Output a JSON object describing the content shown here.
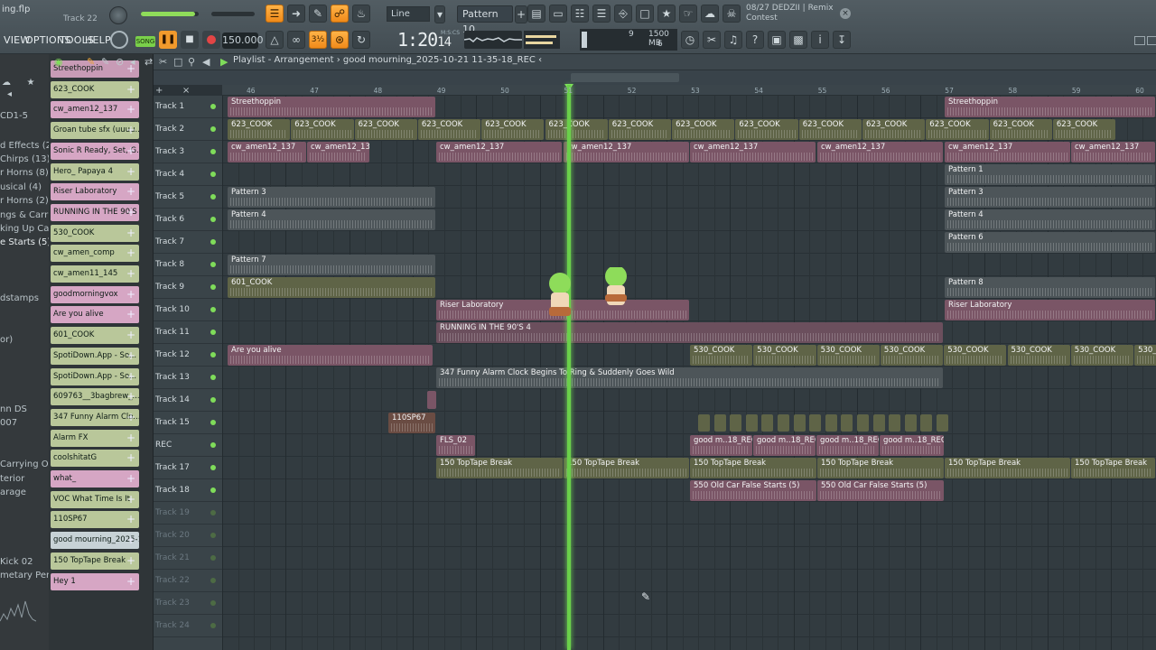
{
  "topbar": {
    "file_name": "ing.flp",
    "track_hint": "Track 22",
    "snap": "Line",
    "pattern": "Pattern 10",
    "tempo": "150.000",
    "time": "1:20",
    "time_sub": "14",
    "time_label": "M:S:CS",
    "cpu_value": "9",
    "mem_value": "1500 MB",
    "mem_sub": "6",
    "news_line1": "08/27  DEDZII | Remix",
    "news_line2": "Contest",
    "song_label": "SONG",
    "menu": [
      "VIEW",
      "OPTIONS",
      "TOOLS",
      "HELP"
    ]
  },
  "playlist": {
    "title": "Playlist - Arrangement",
    "arrangement": "good mourning_2025-10-21 11-35-18_REC",
    "bars": [
      "46",
      "47",
      "48",
      "49",
      "50",
      "51",
      "52",
      "53",
      "54",
      "55",
      "56",
      "57",
      "58",
      "59",
      "60"
    ]
  },
  "browser": {
    "items": [
      "CD1-5",
      "d Effects (2)",
      "Chirps (13)",
      "r Horns (8)",
      "usical (4)",
      "r Horns (2)",
      "ngs & Carria",
      "king Up Car)",
      "e Starts (5)",
      "dstamps",
      "or)",
      "nn DS",
      "007",
      "Carrying On",
      "terior",
      "arage",
      "Kick 02",
      "metary Perc"
    ]
  },
  "channels": [
    {
      "name": "Streethoppin",
      "color": "#c89bb6"
    },
    {
      "name": "623_COOK",
      "color": "#b9c79a"
    },
    {
      "name": "cw_amen12_137",
      "color": "#d6a6c4"
    },
    {
      "name": "Groan tube sfx (uuuu...",
      "color": "#b9c79a"
    },
    {
      "name": "Sonic R Ready, Set, G...",
      "color": "#d6a6c4"
    },
    {
      "name": "Hero_ Papaya 4",
      "color": "#b9c79a"
    },
    {
      "name": "Riser Laboratory",
      "color": "#d6a6c4"
    },
    {
      "name": "RUNNING IN THE 90'S 4",
      "color": "#d6a6c4"
    },
    {
      "name": "530_COOK",
      "color": "#b9c79a"
    },
    {
      "name": "cw_amen_comp",
      "color": "#b9c79a"
    },
    {
      "name": "cw_amen11_145",
      "color": "#b9c79a"
    },
    {
      "name": "goodmorningvox",
      "color": "#d6a6c4"
    },
    {
      "name": "Are you alive",
      "color": "#d6a6c4"
    },
    {
      "name": "601_COOK",
      "color": "#b9c79a"
    },
    {
      "name": "SpotiDown.App - So...",
      "color": "#b9c79a"
    },
    {
      "name": "SpotiDown.App - So...",
      "color": "#b9c79a"
    },
    {
      "name": "609763__3bagbrew_...",
      "color": "#b9c79a"
    },
    {
      "name": "347 Funny Alarm Clo...",
      "color": "#b9c79a"
    },
    {
      "name": "Alarm FX",
      "color": "#b9c79a"
    },
    {
      "name": "coolshitatG",
      "color": "#b9c79a"
    },
    {
      "name": "what_",
      "color": "#d6a6c4"
    },
    {
      "name": "VOC What Time Is It",
      "color": "#b9c79a"
    },
    {
      "name": "110SP67",
      "color": "#b9c79a"
    },
    {
      "name": "good mourning_2025-10...",
      "color": "#c7d2d6"
    },
    {
      "name": "150 TopTape Break",
      "color": "#b9c79a"
    },
    {
      "name": "Hey 1",
      "color": "#d6a6c4"
    }
  ],
  "tracks": [
    "Track 1",
    "Track 2",
    "Track 3",
    "Track 4",
    "Track 5",
    "Track 6",
    "Track 7",
    "Track 8",
    "Track 9",
    "Track 10",
    "Track 11",
    "Track 12",
    "Track 13",
    "Track 14",
    "Track 15",
    "REC",
    "Track 17",
    "Track 18",
    "Track 19",
    "Track 20",
    "Track 21",
    "Track 22",
    "Track 23",
    "Track 24"
  ],
  "clips": {
    "streethoppin": "Streethoppin",
    "cook623": "623_COOK",
    "amen": "cw_amen12_137",
    "pattern1": "Pattern 1",
    "pattern3": "Pattern 3",
    "pattern4": "Pattern 4",
    "pattern6": "Pattern 6",
    "pattern7": "Pattern 7",
    "pattern8": "Pattern 8",
    "cook601": "601_COOK",
    "riser": "Riser Laboratory",
    "running": "RUNNING IN THE 90'S 4",
    "alive": "Are you alive",
    "cook530": "530_COOK",
    "alarm": "347 Funny Alarm Clock Begins To Ring & Suddenly Goes Wild",
    "sp67": "110SP67",
    "fls": "FLS_02",
    "goodm": "good m..18_REC",
    "toptape": "150 TopTape Break",
    "oldcar": "550 Old Car False Starts (5)"
  },
  "colors": {
    "accent_orange": "#f39a2a",
    "playhead": "#6ad04a",
    "clip_pink": "#7a5566",
    "clip_olive": "#5f6447",
    "clip_gray": "#4d5559"
  }
}
